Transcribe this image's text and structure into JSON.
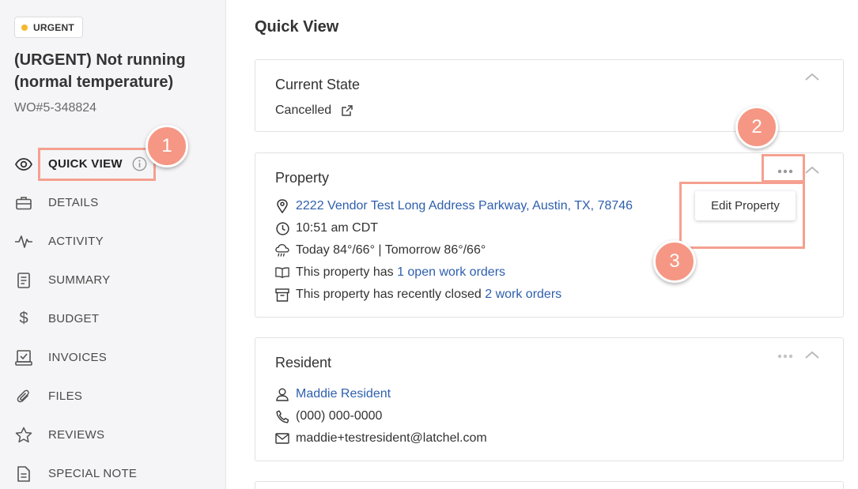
{
  "sidebar": {
    "badge": "URGENT",
    "title": "(URGENT) Not running (normal temperature)",
    "wo_number": "WO#5-348824",
    "items": [
      {
        "label": "QUICK VIEW",
        "icon": "eye-icon",
        "active": true
      },
      {
        "label": "DETAILS",
        "icon": "briefcase-icon"
      },
      {
        "label": "ACTIVITY",
        "icon": "activity-icon"
      },
      {
        "label": "SUMMARY",
        "icon": "document-icon"
      },
      {
        "label": "BUDGET",
        "icon": "dollar-icon"
      },
      {
        "label": "INVOICES",
        "icon": "invoice-icon"
      },
      {
        "label": "FILES",
        "icon": "paperclip-icon"
      },
      {
        "label": "REVIEWS",
        "icon": "star-icon"
      },
      {
        "label": "SPECIAL NOTE",
        "icon": "note-icon"
      }
    ]
  },
  "main": {
    "title": "Quick View",
    "current_state": {
      "title": "Current State",
      "value": "Cancelled"
    },
    "property": {
      "title": "Property",
      "address": "2222 Vendor Test Long Address Parkway, Austin, TX, 78746",
      "time": "10:51 am CDT",
      "weather": "Today 84°/66° | Tomorrow 86°/66°",
      "open_prefix": "This property has ",
      "open_link": "1 open work orders",
      "closed_prefix": "This property has recently closed ",
      "closed_link": "2 work orders",
      "menu_item": "Edit Property"
    },
    "resident": {
      "title": "Resident",
      "name": "Maddie Resident",
      "phone": "(000) 000-0000",
      "email": "maddie+testresident@latchel.com"
    }
  },
  "annotations": [
    "1",
    "2",
    "3"
  ],
  "colors": {
    "accent_link": "#2e5fad",
    "badge_dot": "#f5b82e",
    "annotation": "#f59784"
  }
}
